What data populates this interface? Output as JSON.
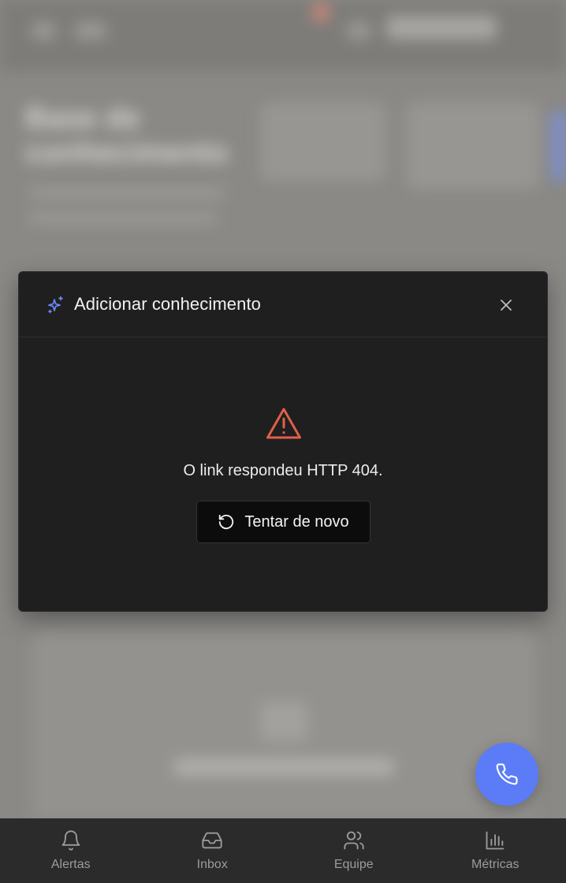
{
  "background": {
    "page_title": "Base de conhecimento"
  },
  "modal": {
    "title": "Adicionar conhecimento",
    "title_icon": "sparkles-icon",
    "close_icon": "close-icon",
    "error_icon": "warning-triangle-icon",
    "error_message": "O link respondeu HTTP 404.",
    "retry_label": "Tentar de novo",
    "retry_icon": "rotate-ccw-icon"
  },
  "fab": {
    "icon": "phone-icon",
    "color": "#5b7cf6"
  },
  "bottom_nav": {
    "items": [
      {
        "label": "Alertas",
        "icon": "bell-icon"
      },
      {
        "label": "Inbox",
        "icon": "inbox-icon"
      },
      {
        "label": "Equipe",
        "icon": "users-icon"
      },
      {
        "label": "Métricas",
        "icon": "bar-chart-icon"
      }
    ]
  },
  "colors": {
    "accent": "#5b7cf6",
    "warning": "#e0604a",
    "modal_bg": "#1f1f1f",
    "nav_bg": "#2b2b2b"
  }
}
